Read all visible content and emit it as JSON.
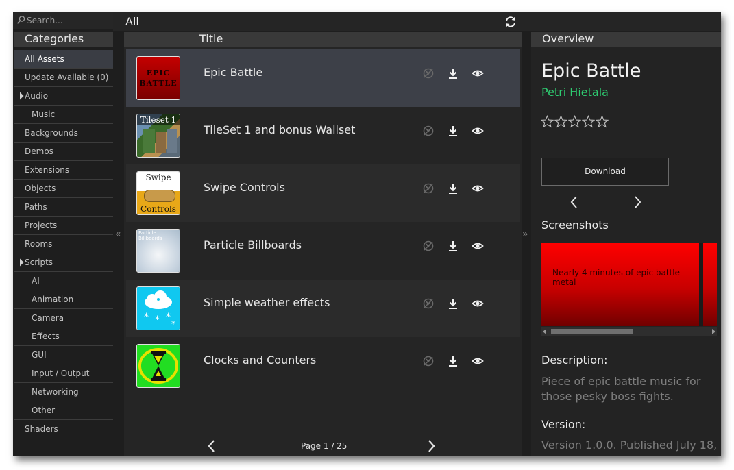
{
  "search": {
    "placeholder": "Search..."
  },
  "sidebar": {
    "header": "Categories",
    "items": [
      {
        "label": "All Assets",
        "level": 0,
        "selected": true,
        "expander": false
      },
      {
        "label": "Update Available (0)",
        "level": 0,
        "selected": false,
        "expander": false
      },
      {
        "label": "Audio",
        "level": 0,
        "selected": false,
        "expander": true
      },
      {
        "label": "Music",
        "level": 1,
        "selected": false,
        "expander": false
      },
      {
        "label": "Backgrounds",
        "level": 0,
        "selected": false,
        "expander": false
      },
      {
        "label": "Demos",
        "level": 0,
        "selected": false,
        "expander": false
      },
      {
        "label": "Extensions",
        "level": 0,
        "selected": false,
        "expander": false
      },
      {
        "label": "Objects",
        "level": 0,
        "selected": false,
        "expander": false
      },
      {
        "label": "Paths",
        "level": 0,
        "selected": false,
        "expander": false
      },
      {
        "label": "Projects",
        "level": 0,
        "selected": false,
        "expander": false
      },
      {
        "label": "Rooms",
        "level": 0,
        "selected": false,
        "expander": false
      },
      {
        "label": "Scripts",
        "level": 0,
        "selected": false,
        "expander": true
      },
      {
        "label": "AI",
        "level": 1,
        "selected": false,
        "expander": false
      },
      {
        "label": "Animation",
        "level": 1,
        "selected": false,
        "expander": false
      },
      {
        "label": "Camera",
        "level": 1,
        "selected": false,
        "expander": false
      },
      {
        "label": "Effects",
        "level": 1,
        "selected": false,
        "expander": false
      },
      {
        "label": "GUI",
        "level": 1,
        "selected": false,
        "expander": false
      },
      {
        "label": "Input / Output",
        "level": 1,
        "selected": false,
        "expander": false
      },
      {
        "label": "Networking",
        "level": 1,
        "selected": false,
        "expander": false
      },
      {
        "label": "Other",
        "level": 1,
        "selected": false,
        "expander": false
      },
      {
        "label": "Shaders",
        "level": 0,
        "selected": false,
        "expander": false
      }
    ]
  },
  "topbar": {
    "breadcrumb": "All",
    "refresh_icon": "refresh-icon"
  },
  "list": {
    "header": "Title",
    "rows": [
      {
        "title": "Epic Battle",
        "thumb": "epic-battle",
        "selected": true
      },
      {
        "title": "TileSet 1 and bonus Wallset",
        "thumb": "tileset",
        "selected": false
      },
      {
        "title": "Swipe Controls",
        "thumb": "swipe",
        "selected": false
      },
      {
        "title": "Particle Billboards",
        "thumb": "particle",
        "selected": false
      },
      {
        "title": "Simple weather effects",
        "thumb": "weather",
        "selected": false
      },
      {
        "title": "Clocks and Counters",
        "thumb": "clocks",
        "selected": false
      }
    ],
    "thumb_text": {
      "epic_battle": "EPIC BATTLE",
      "tileset": "Tileset 1",
      "swipe_top": "Swipe",
      "swipe_bottom": "Controls",
      "particle": "Particle Billboards"
    },
    "pager": {
      "label": "Page 1 / 25"
    }
  },
  "overview": {
    "header": "Overview",
    "name": "Epic Battle",
    "author": "Petri Hietala",
    "rating": 0,
    "max_rating": 5,
    "download_label": "Download",
    "screenshots_label": "Screenshots",
    "screenshot_caption": "Nearly 4 minutes of epic battle metal",
    "description_label": "Description:",
    "description": "Piece of epic battle music for those pesky boss fights.",
    "version_label": "Version:",
    "version": "Version 1.0.0. Published July 18,"
  },
  "colors": {
    "accent_author": "#2ecc71",
    "selected_row": "#3d4048",
    "background": "#1e1e1e"
  }
}
